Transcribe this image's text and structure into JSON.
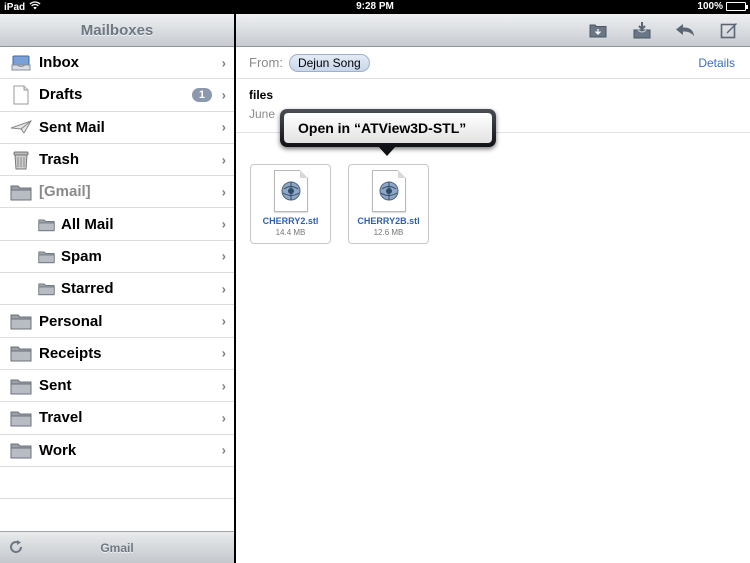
{
  "status_bar": {
    "device": "iPad",
    "time": "9:28 PM",
    "battery": "100%",
    "battery_level": 1.0
  },
  "sidebar": {
    "title": "Mailboxes",
    "items": [
      {
        "label": "Inbox",
        "icon": "inbox-icon"
      },
      {
        "label": "Drafts",
        "icon": "drafts-icon",
        "badge": "1"
      },
      {
        "label": "Sent Mail",
        "icon": "sent-mail-icon"
      },
      {
        "label": "Trash",
        "icon": "trash-icon"
      },
      {
        "label": "[Gmail]",
        "icon": "folder-icon"
      },
      {
        "label": "All Mail",
        "icon": "folder-icon"
      },
      {
        "label": "Spam",
        "icon": "folder-icon"
      },
      {
        "label": "Starred",
        "icon": "folder-icon"
      },
      {
        "label": "Personal",
        "icon": "folder-icon"
      },
      {
        "label": "Receipts",
        "icon": "folder-icon"
      },
      {
        "label": "Sent",
        "icon": "folder-icon"
      },
      {
        "label": "Travel",
        "icon": "folder-icon"
      },
      {
        "label": "Work",
        "icon": "folder-icon"
      }
    ],
    "toolbar": {
      "account": "Gmail",
      "refresh_icon": "refresh-icon"
    }
  },
  "message": {
    "toolbar_icons": [
      "move-folder-icon",
      "archive-icon",
      "reply-icon",
      "compose-icon"
    ],
    "from_label": "From:",
    "from_name": "Dejun Song",
    "details_label": "Details",
    "subject": "files",
    "date": "June",
    "attachments": [
      {
        "name": "CHERRY2.stl",
        "size": "14.4 MB"
      },
      {
        "name": "CHERRY2B.stl",
        "size": "12.6 MB"
      }
    ]
  },
  "popover": {
    "action_label": "Open in “ATView3D-STL”"
  },
  "colors": {
    "link": "#3a6fc4",
    "badge": "#8b98ad",
    "toolbar_top": "#eef0f2",
    "toolbar_bottom": "#c7cbd0"
  }
}
